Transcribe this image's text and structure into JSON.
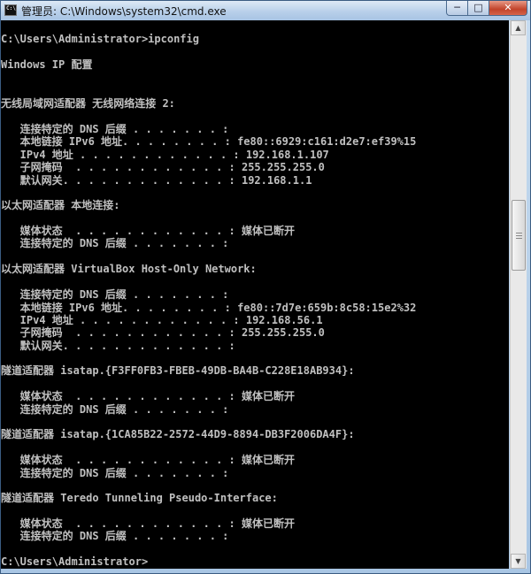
{
  "window": {
    "title": "管理员: C:\\Windows\\system32\\cmd.exe",
    "controls": {
      "minimize": "─",
      "maximize": "□",
      "close": "✕"
    },
    "icon": "cmd-icon"
  },
  "console": {
    "lines": [
      "C:\\Users\\Administrator>ipconfig",
      "Windows IP 配置",
      "无线局域网适配器 无线网络连接 2:",
      "   连接特定的 DNS 后缀 . . . . . . . :",
      "   本地链接 IPv6 地址. . . . . . . . : fe80::6929:c161:d2e7:ef39%15",
      "   IPv4 地址 . . . . . . . . . . . . : 192.168.1.107",
      "   子网掩码  . . . . . . . . . . . . : 255.255.255.0",
      "   默认网关. . . . . . . . . . . . . : 192.168.1.1",
      "以太网适配器 本地连接:",
      "   媒体状态  . . . . . . . . . . . . : 媒体已断开",
      "   连接特定的 DNS 后缀 . . . . . . . :",
      "以太网适配器 VirtualBox Host-Only Network:",
      "   连接特定的 DNS 后缀 . . . . . . . :",
      "   本地链接 IPv6 地址. . . . . . . . : fe80::7d7e:659b:8c58:15e2%32",
      "   IPv4 地址 . . . . . . . . . . . . : 192.168.56.1",
      "   子网掩码  . . . . . . . . . . . . : 255.255.255.0",
      "   默认网关. . . . . . . . . . . . . :",
      "隧道适配器 isatap.{F3FF0FB3-FBEB-49DB-BA4B-C228E18AB934}:",
      "   媒体状态  . . . . . . . . . . . . : 媒体已断开",
      "   连接特定的 DNS 后缀 . . . . . . . :",
      "隧道适配器 isatap.{1CA85B22-2572-44D9-8894-DB3F2006DA4F}:",
      "   媒体状态  . . . . . . . . . . . . : 媒体已断开",
      "   连接特定的 DNS 后缀 . . . . . . . :",
      "隧道适配器 Teredo Tunneling Pseudo-Interface:",
      "   媒体状态  . . . . . . . . . . . . : 媒体已断开",
      "   连接特定的 DNS 后缀 . . . . . . . :",
      "C:\\Users\\Administrator>"
    ]
  },
  "scrollbar": {
    "up_arrow": "▲",
    "down_arrow": "▼"
  }
}
